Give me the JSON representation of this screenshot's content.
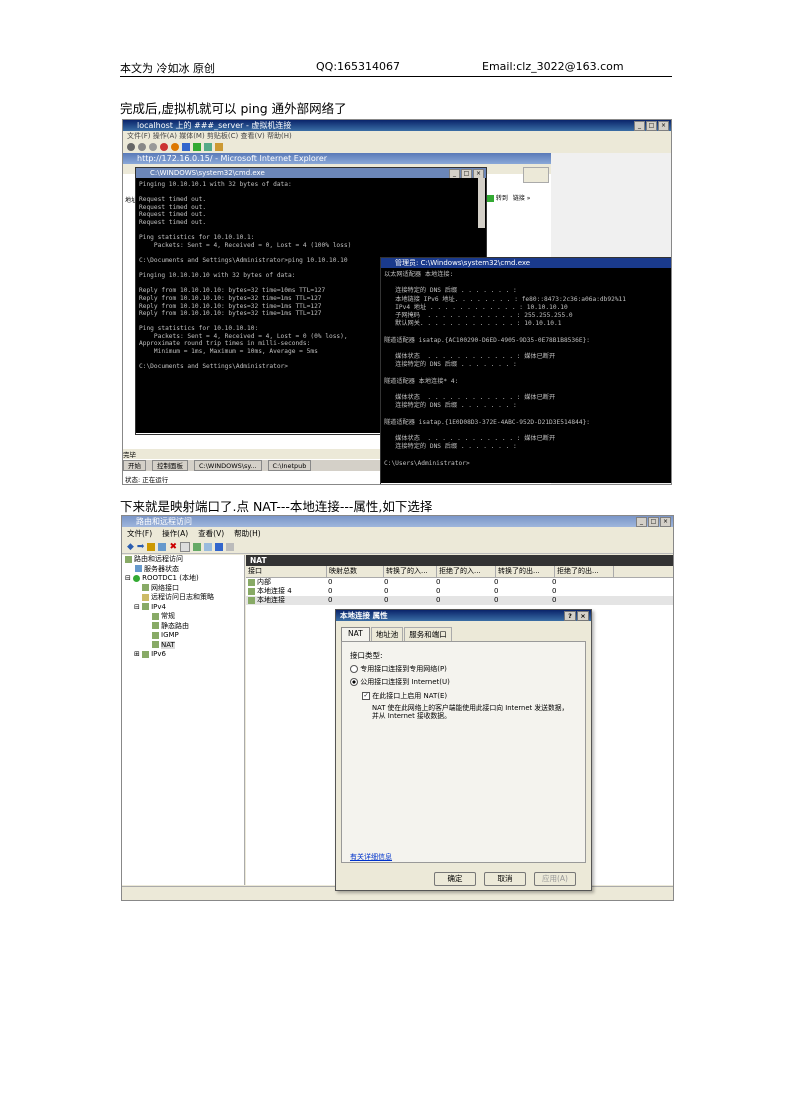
{
  "header": {
    "author": "本文为 冷如冰 原创",
    "qq": "QQ:165314067",
    "email": "Email:clz_3022@163.com"
  },
  "captions": {
    "first": "完成后,虚拟机就可以 ping 通外部网络了",
    "second": "下来就是映射端口了.点 NAT---本地连接---属性,如下选择"
  },
  "screenshot1": {
    "vm_title": "localhost 上的 ###_server - 虚拟机连接",
    "vm_menu": "文件(F)  操作(A)  媒体(M)  剪贴板(C)  查看(V)  帮助(H)",
    "ie_title": "http://172.16.0.15/ - Microsoft Internet Explorer",
    "ie_addr_label": "地址",
    "ie_go": "转到",
    "ie_links": "链接 »",
    "cmd1_title": "C:\\WINDOWS\\system32\\cmd.exe",
    "cmd1_lines": [
      "Pinging 10.10.10.1 with 32 bytes of data:",
      "",
      "Request timed out.",
      "Request timed out.",
      "Request timed out.",
      "Request timed out.",
      "",
      "Ping statistics for 10.10.10.1:",
      "    Packets: Sent = 4, Received = 0, Lost = 4 (100% loss)",
      "",
      "C:\\Documents and Settings\\Administrator>ping 10.10.10.10",
      "",
      "Pinging 10.10.10.10 with 32 bytes of data:",
      "",
      "Reply from 10.10.10.10: bytes=32 time=10ms TTL=127",
      "Reply from 10.10.10.10: bytes=32 time=1ms TTL=127",
      "Reply from 10.10.10.10: bytes=32 time=1ms TTL=127",
      "Reply from 10.10.10.10: bytes=32 time=1ms TTL=127",
      "",
      "Ping statistics for 10.10.10.10:",
      "    Packets: Sent = 4, Received = 4, Lost = 0 (0% loss),",
      "Approximate round trip times in milli-seconds:",
      "    Minimum = 1ms, Maximum = 10ms, Average = 5ms",
      "",
      "C:\\Documents and Settings\\Administrator>"
    ],
    "cmd2_title": "管理员: C:\\Windows\\system32\\cmd.exe",
    "cmd2_lines": [
      "以太网适配器 本地连接:",
      "",
      "   连接特定的 DNS 后缀 . . . . . . . :",
      "   本地链接 IPv6 地址. . . . . . . . : fe80::8473:2c36:a06a:db92%11",
      "   IPv4 地址 . . . . . . . . . . . . : 10.10.10.10",
      "   子网掩码  . . . . . . . . . . . . : 255.255.255.0",
      "   默认网关. . . . . . . . . . . . . : 10.10.10.1",
      "",
      "隧道适配器 isatap.{AC100290-D6ED-4905-9D35-0E78B1B8536E}:",
      "",
      "   媒体状态  . . . . . . . . . . . . : 媒体已断开",
      "   连接特定的 DNS 后缀 . . . . . . . :",
      "",
      "隧道适配器 本地连接* 4:",
      "",
      "   媒体状态  . . . . . . . . . . . . : 媒体已断开",
      "   连接特定的 DNS 后缀 . . . . . . . :",
      "",
      "隧道适配器 isatap.{1E0D08D3-372E-4ABC-952D-D21D3E514844}:",
      "",
      "   媒体状态  . . . . . . . . . . . . : 媒体已断开",
      "   连接特定的 DNS 后缀 . . . . . . . :",
      "",
      "C:\\Users\\Administrator>"
    ],
    "ie_status": "完毕",
    "taskbar_start": "开始",
    "taskbar_items": [
      "控制面板",
      "C:\\WINDOWS\\sy...",
      "C:\\Inetpub"
    ],
    "vm_status": "状态: 正在运行"
  },
  "screenshot2": {
    "title": "路由和远程访问",
    "menu": [
      "文件(F)",
      "操作(A)",
      "查看(V)",
      "帮助(H)"
    ],
    "tree": [
      "路由和远程访问",
      "服务器状态",
      "ROOTDC1 (本地)",
      "网络接口",
      "远程访问日志和策略",
      "IPv4",
      "常规",
      "静态路由",
      "IGMP",
      "NAT",
      "IPv6"
    ],
    "pane_title": "NAT",
    "columns": [
      "接口",
      "映射总数",
      "转换了的入...",
      "拒绝了的入...",
      "转换了的出...",
      "拒绝了的出..."
    ],
    "rows": [
      [
        "内部",
        "0",
        "0",
        "0",
        "0",
        "0"
      ],
      [
        "本地连接 4",
        "0",
        "0",
        "0",
        "0",
        "0"
      ],
      [
        "本地连接",
        "0",
        "0",
        "0",
        "0",
        "0"
      ]
    ],
    "dialog": {
      "title": "本地连接 属性",
      "help": "?",
      "close": "×",
      "tabs": [
        "NAT",
        "地址池",
        "服务和端口"
      ],
      "group_label": "接口类型:",
      "radio_private": "专用接口连接到专用网络(P)",
      "radio_public": "公用接口连接到 Internet(U)",
      "checkbox": "在此接口上启用 NAT(E)",
      "description": "NAT 使在此网络上的客户端能使用此接口向 Internet 发送数据，并从 Internet 接收数据。",
      "link": "有关详细信息",
      "ok": "确定",
      "cancel": "取消",
      "apply": "应用(A)"
    }
  }
}
